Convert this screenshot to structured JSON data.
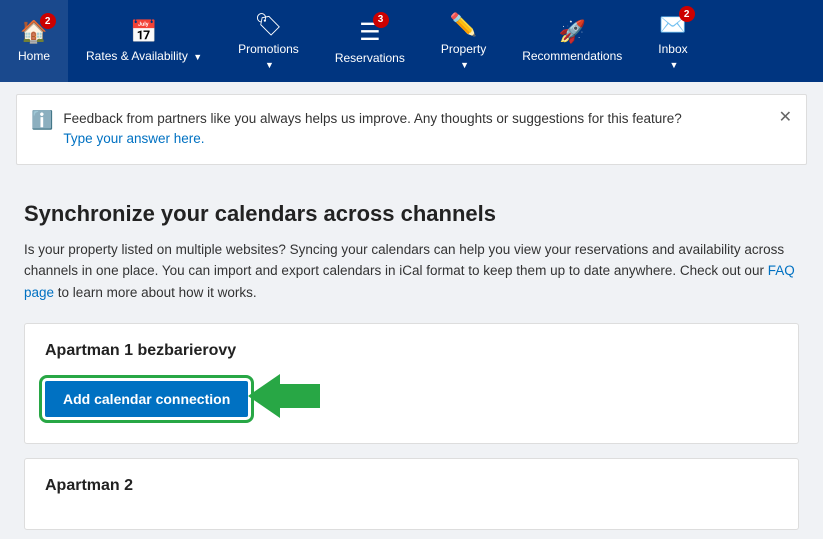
{
  "nav": {
    "items": [
      {
        "id": "home",
        "label": "Home",
        "icon": "🏠",
        "badge": 2,
        "has_chevron": false
      },
      {
        "id": "rates",
        "label": "Rates & Availability",
        "icon": "📅",
        "badge": null,
        "has_chevron": true
      },
      {
        "id": "promotions",
        "label": "Promotions",
        "icon": "🏷",
        "badge": null,
        "has_chevron": true
      },
      {
        "id": "reservations",
        "label": "Reservations",
        "icon": "≡",
        "badge": 3,
        "has_chevron": false
      },
      {
        "id": "property",
        "label": "Property",
        "icon": "✏",
        "badge": null,
        "has_chevron": true
      },
      {
        "id": "recommendations",
        "label": "Recommendations",
        "icon": "🚀",
        "badge": null,
        "has_chevron": false
      },
      {
        "id": "inbox",
        "label": "Inbox",
        "icon": "✉",
        "badge": 2,
        "has_chevron": true
      }
    ]
  },
  "feedback": {
    "text": "Feedback from partners like you always helps us improve. Any thoughts or suggestions for this feature?",
    "link_text": "Type your answer here.",
    "icon": "ℹ"
  },
  "page": {
    "title": "Synchronize your calendars across channels",
    "description_part1": "Is your property listed on multiple websites? Syncing your calendars can help you view your reservations and availability across channels in one place. You can import and export calendars in iCal format to keep them up to date anywhere. Check out our ",
    "faq_link": "FAQ page",
    "description_part2": " to learn more about how it works."
  },
  "properties": [
    {
      "id": "prop1",
      "name": "Apartman 1 bezbarierovy",
      "show_button": true
    },
    {
      "id": "prop2",
      "name": "Apartman 2",
      "show_button": false
    }
  ],
  "add_calendar_label": "Add calendar connection"
}
